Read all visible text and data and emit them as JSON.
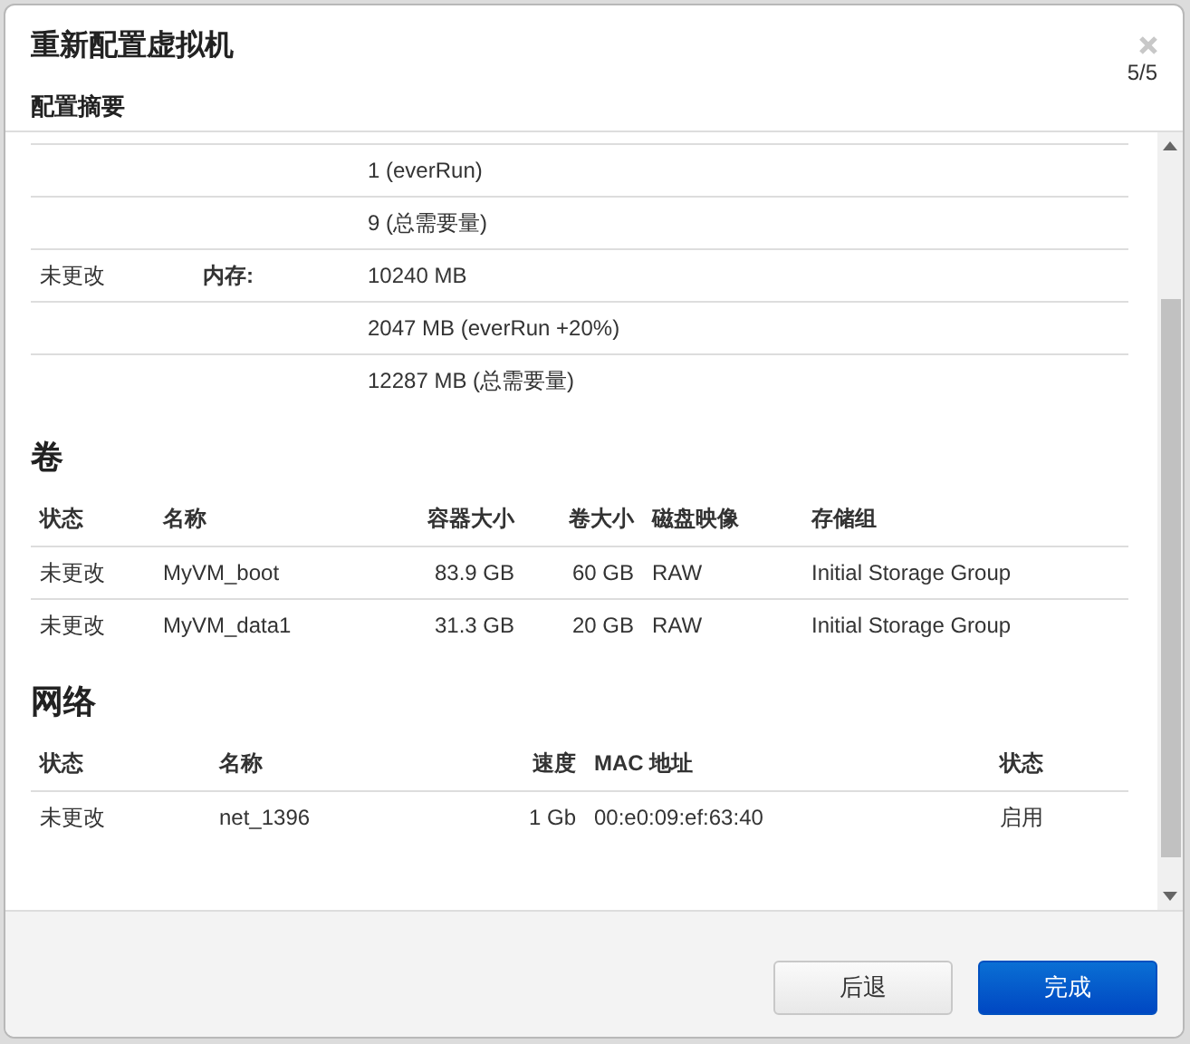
{
  "dialog": {
    "title": "重新配置虚拟机",
    "subtitle": "配置摘要",
    "step": "5/5"
  },
  "summary": {
    "rows": [
      {
        "status": "",
        "label": "",
        "value": "1 (everRun)"
      },
      {
        "status": "",
        "label": "",
        "value": "9 (总需要量)"
      },
      {
        "status": "未更改",
        "label": "内存:",
        "value": "10240 MB"
      },
      {
        "status": "",
        "label": "",
        "value": "2047 MB (everRun +20%)"
      },
      {
        "status": "",
        "label": "",
        "value": "12287 MB (总需要量)"
      }
    ]
  },
  "volumes": {
    "heading": "卷",
    "columns": [
      "状态",
      "名称",
      "容器大小",
      "卷大小",
      "磁盘映像",
      "存储组"
    ],
    "rows": [
      [
        "未更改",
        "MyVM_boot",
        "83.9 GB",
        "60 GB",
        "RAW",
        "Initial Storage Group"
      ],
      [
        "未更改",
        "MyVM_data1",
        "31.3 GB",
        "20 GB",
        "RAW",
        "Initial Storage Group"
      ]
    ]
  },
  "network": {
    "heading": "网络",
    "columns": [
      "状态",
      "名称",
      "速度",
      "MAC 地址",
      "状态"
    ],
    "rows": [
      [
        "未更改",
        "net_1396",
        "1 Gb",
        "00:e0:09:ef:63:40",
        "启用"
      ]
    ]
  },
  "buttons": [
    {
      "label": "后退",
      "kind": "secondary"
    },
    {
      "label": "完成",
      "kind": "primary"
    }
  ]
}
